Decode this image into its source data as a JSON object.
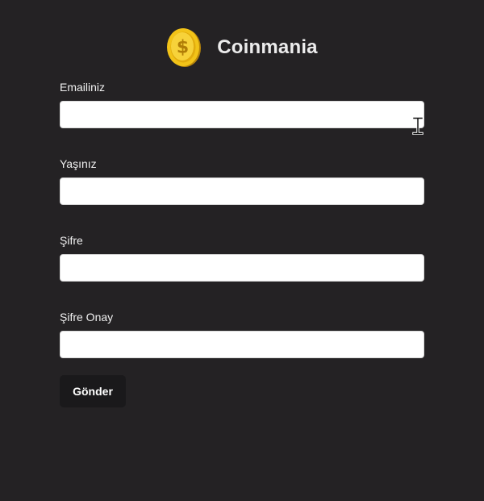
{
  "brand": {
    "title": "Coinmania",
    "icon": "gold-dollar-coin-icon"
  },
  "form": {
    "fields": [
      {
        "label": "Emailiniz",
        "value": "",
        "placeholder": ""
      },
      {
        "label": "Yaşınız",
        "value": "",
        "placeholder": ""
      },
      {
        "label": "Şifre",
        "value": "",
        "placeholder": ""
      },
      {
        "label": "Şifre Onay",
        "value": "",
        "placeholder": ""
      }
    ],
    "submit_label": "Gönder"
  },
  "colors": {
    "background": "#242224",
    "input_background": "#ffffff",
    "button_background": "#1a191b",
    "coin_gold": "#f2c318"
  },
  "cursor": "i-beam-text-cursor"
}
